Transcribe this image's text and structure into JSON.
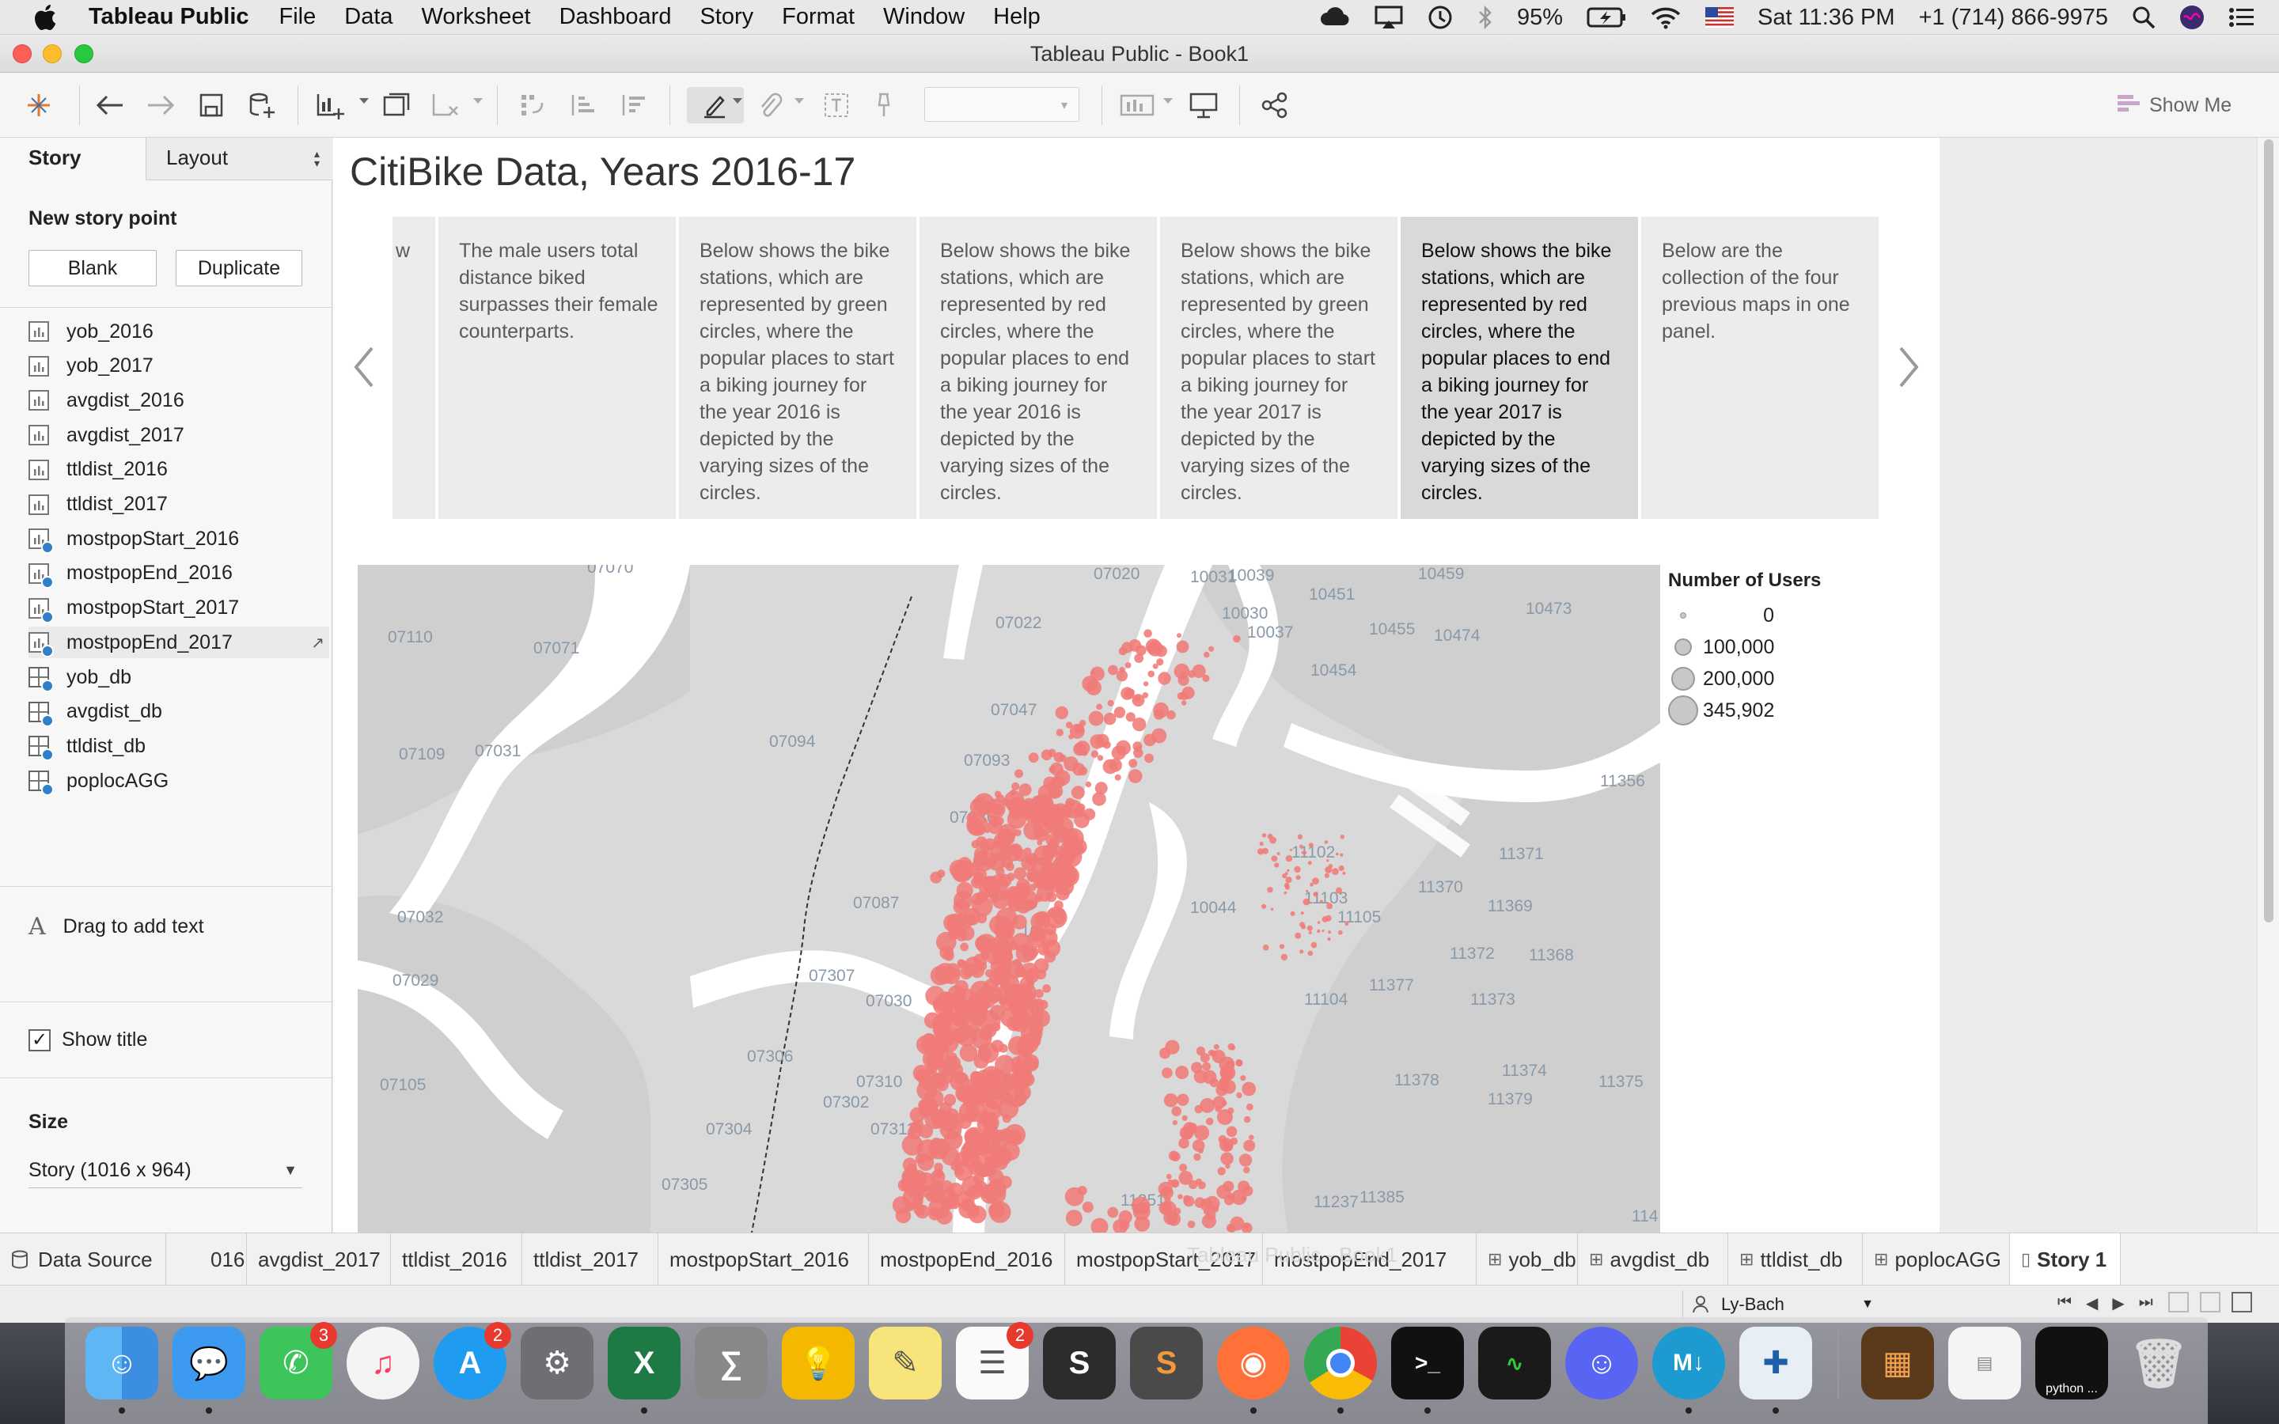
{
  "menubar": {
    "items": [
      "Tableau Public",
      "File",
      "Data",
      "Worksheet",
      "Dashboard",
      "Story",
      "Format",
      "Window",
      "Help"
    ],
    "battery": "95%",
    "clock": "Sat 11:36 PM",
    "phone": "+1 (714) 866-9975"
  },
  "window": {
    "title": "Tableau Public - Book1"
  },
  "toolbar": {
    "show_me": "Show Me"
  },
  "leftpane": {
    "tab_story": "Story",
    "tab_layout": "Layout",
    "new_story_point": "New story point",
    "blank_button": "Blank",
    "duplicate_button": "Duplicate",
    "sheets": [
      {
        "name": "yob_2016",
        "type": "sheet"
      },
      {
        "name": "yob_2017",
        "type": "sheet"
      },
      {
        "name": "avgdist_2016",
        "type": "sheet"
      },
      {
        "name": "avgdist_2017",
        "type": "sheet"
      },
      {
        "name": "ttldist_2016",
        "type": "sheet"
      },
      {
        "name": "ttldist_2017",
        "type": "sheet"
      },
      {
        "name": "mostpopStart_2016",
        "type": "sheet-used"
      },
      {
        "name": "mostpopEnd_2016",
        "type": "sheet-used"
      },
      {
        "name": "mostpopStart_2017",
        "type": "sheet-used"
      },
      {
        "name": "mostpopEnd_2017",
        "type": "sheet-used"
      },
      {
        "name": "yob_db",
        "type": "dashboard"
      },
      {
        "name": "avgdist_db",
        "type": "dashboard"
      },
      {
        "name": "ttldist_db",
        "type": "dashboard"
      },
      {
        "name": "poplocAGG",
        "type": "dashboard"
      }
    ],
    "drag_text": "Drag to add text",
    "show_title": "Show title",
    "size_label": "Size",
    "size_value": "Story (1016 x 964)"
  },
  "story": {
    "title": "CitiBike Data, Years 2016-17",
    "points": [
      {
        "text": "w",
        "selected": false
      },
      {
        "text": "The male users total distance biked surpasses their female counterparts.",
        "selected": false
      },
      {
        "text": "Below shows the bike stations, which are represented by green circles, where the popular places to start a biking journey for the year 2016 is depicted by the varying sizes of the circles.",
        "selected": false
      },
      {
        "text": "Below shows the bike stations, which are represented by red circles, where the popular places to end a biking journey for the year 2016 is depicted by the varying sizes of the circles.",
        "selected": false
      },
      {
        "text": "Below shows the bike stations, which are represented by green circles, where the popular places to start a biking journey for the year 2017 is depicted by the varying sizes of the circles.",
        "selected": false
      },
      {
        "text": "Below shows the bike stations, which are represented by red circles, where the popular places to end a biking journey for the year 2017 is depicted by the varying sizes of the circles.",
        "selected": true
      },
      {
        "text": "Below are the collection of the four previous maps in one panel.",
        "selected": false
      }
    ]
  },
  "map": {
    "marker_color": "#f07b78",
    "zip_labels": [
      "07070",
      "07020",
      "10031",
      "10039",
      "10459",
      "10451",
      "10473",
      "07110",
      "07071",
      "07022",
      "10030",
      "10037",
      "10455",
      "10474",
      "10454",
      "07047",
      "07094",
      "07109",
      "07031",
      "07093",
      "11356",
      "07086",
      "11371",
      "11370",
      "07087",
      "10044",
      "11103",
      "11369",
      "07032",
      "11372",
      "11368",
      "07307",
      "07030",
      "11104",
      "11377",
      "11373",
      "07029",
      "07306",
      "07310",
      "11378",
      "11374",
      "11375",
      "07105",
      "07302",
      "07311",
      "11379",
      "07304",
      "07305",
      "11251",
      "11237",
      "11385",
      "114",
      "10",
      "11105",
      "11102"
    ],
    "legend": {
      "title": "Number of Users",
      "entries": [
        "0",
        "100,000",
        "200,000",
        "345,902"
      ]
    }
  },
  "tabs": {
    "data_source": "Data Source",
    "sheets": [
      "016",
      "avgdist_2017",
      "ttldist_2016",
      "ttldist_2017",
      "mostpopStart_2016",
      "mostpopEnd_2016",
      "mostpopStart_2017",
      "mostpopEnd_2017",
      "yob_db",
      "avgdist_db",
      "ttldist_db",
      "poplocAGG",
      "Story 1"
    ]
  },
  "status": {
    "user": "Ly-Bach",
    "watermark": "Tableau Public - Book1"
  },
  "dock": {
    "badges": {
      "facetime": "3",
      "appstore": "2",
      "reminders": "2"
    },
    "terminal_label": "python ..."
  }
}
